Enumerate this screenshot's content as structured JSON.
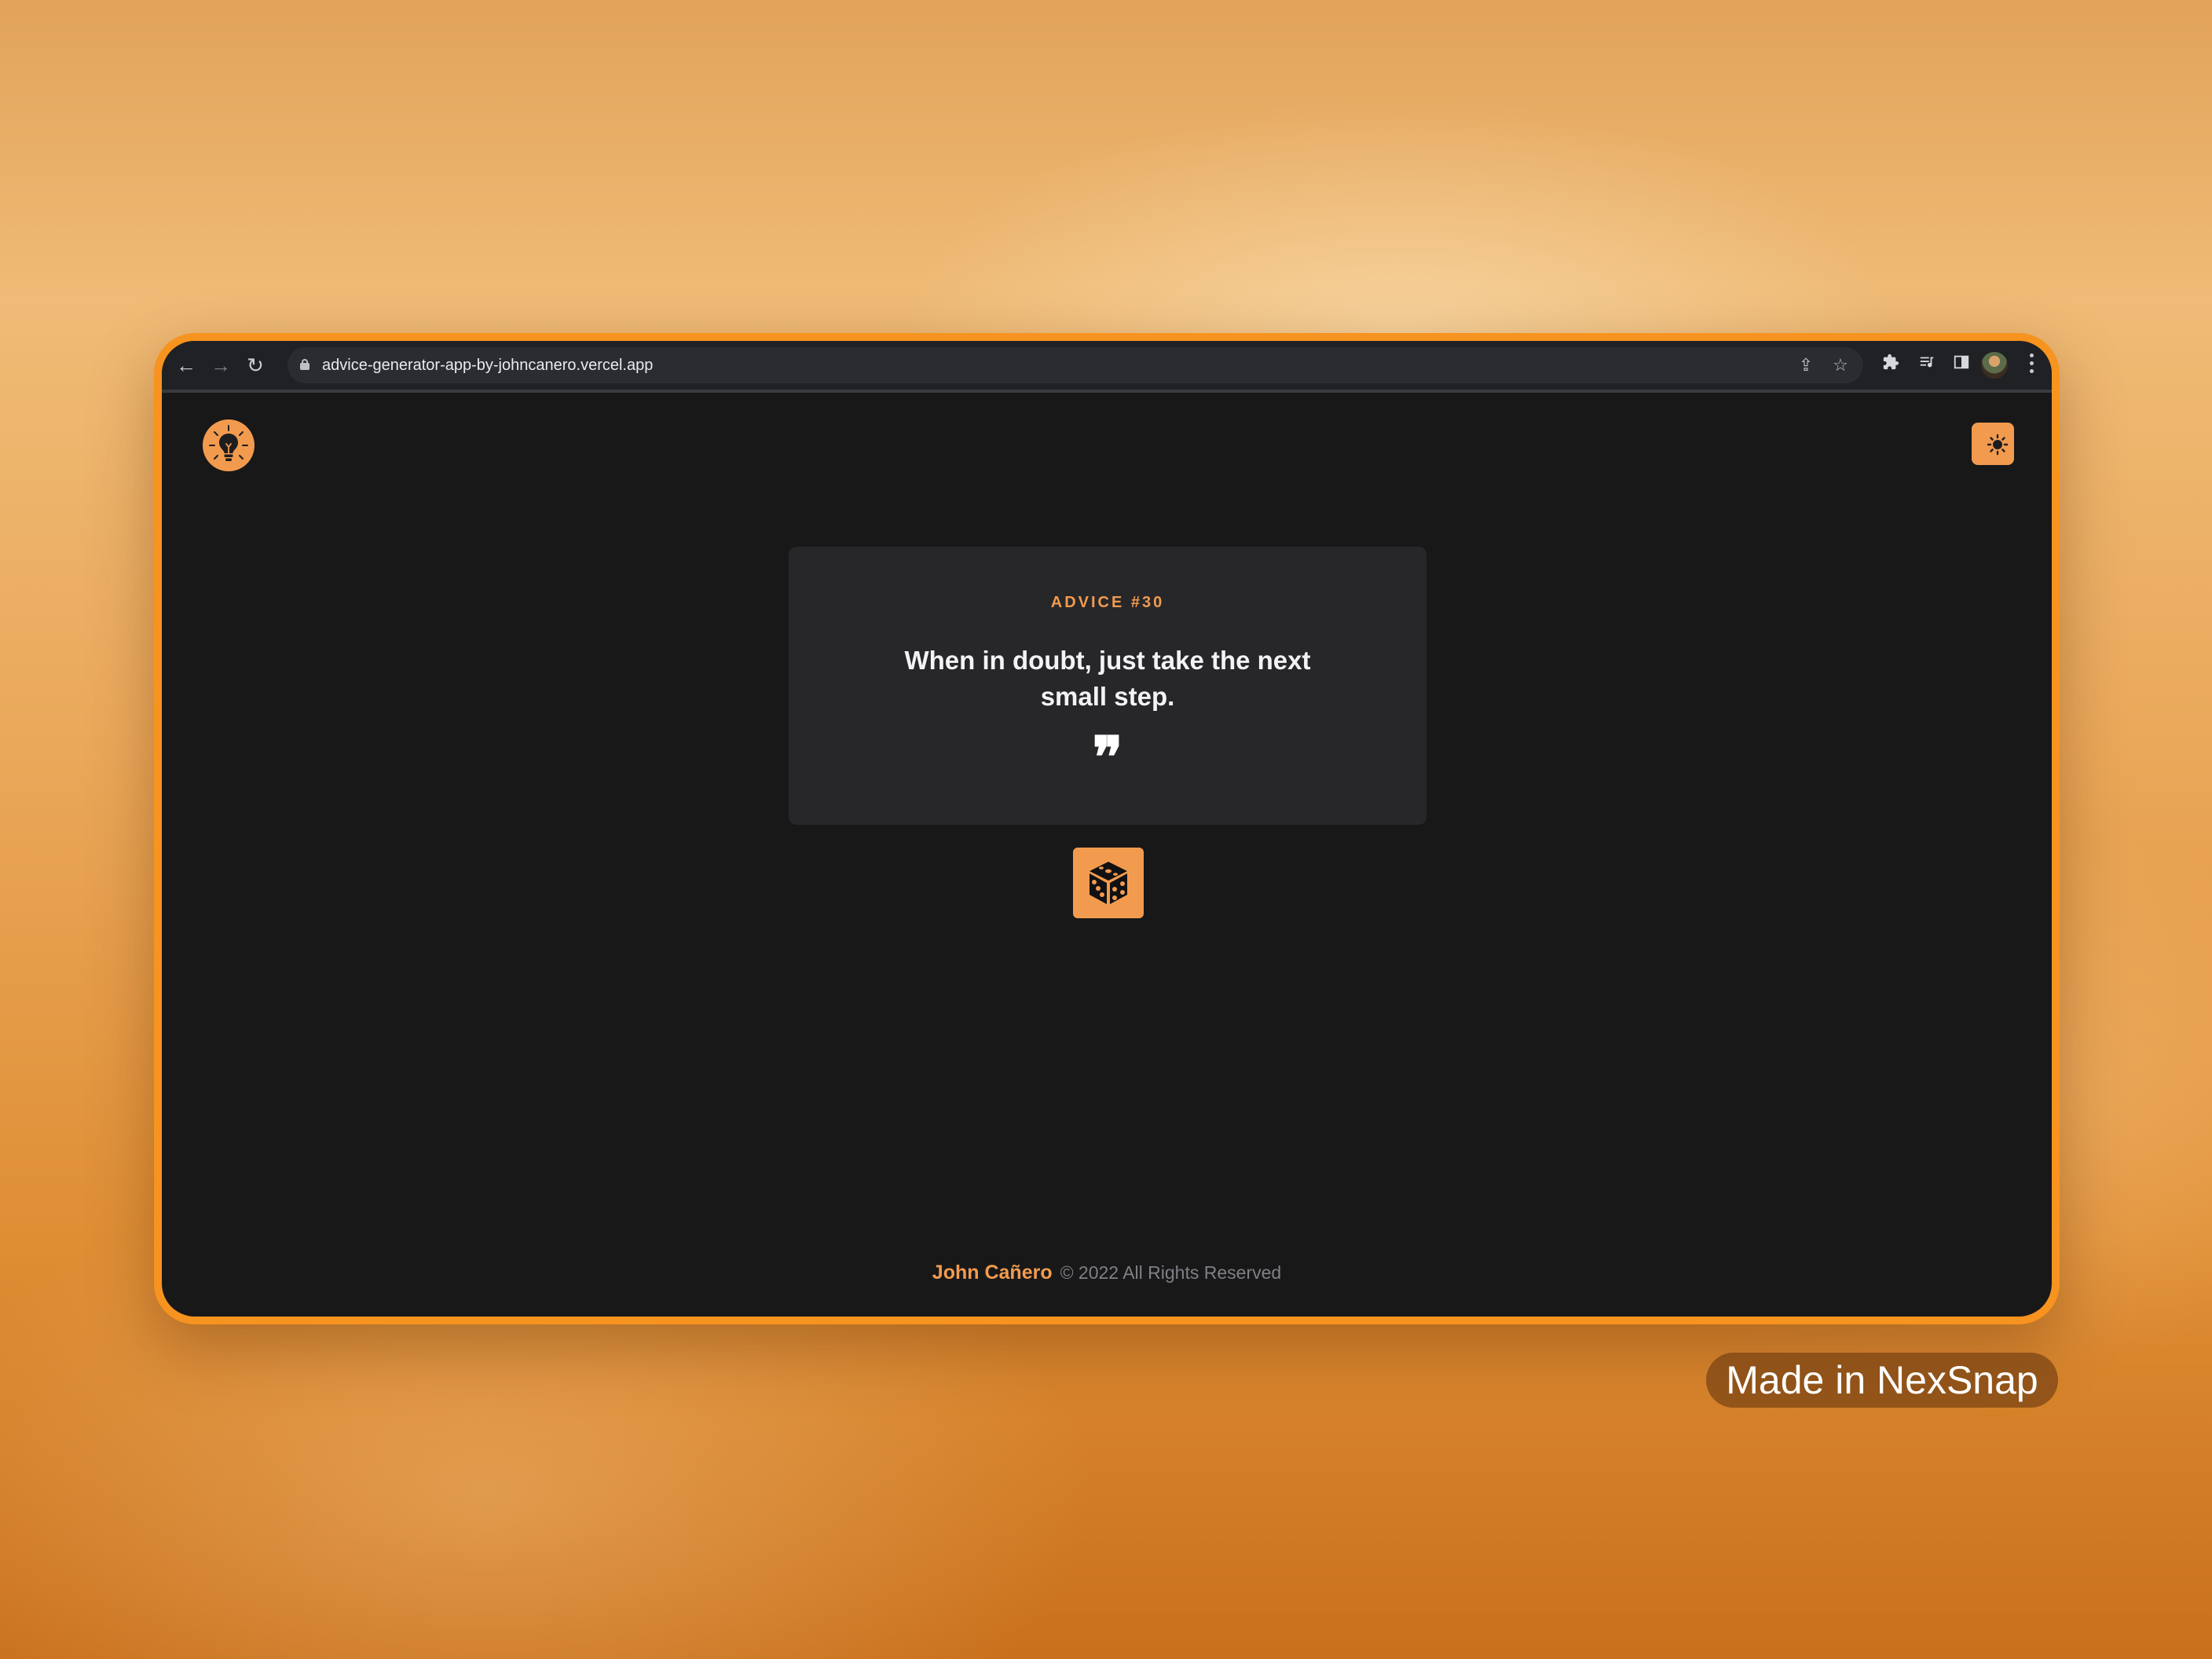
{
  "browser": {
    "url": "advice-generator-app-by-johncanero.vercel.app",
    "back_icon": "←",
    "forward_icon": "→",
    "reload_icon": "↻",
    "share_icon": "⇪",
    "star_icon": "☆"
  },
  "app": {
    "logo_icon": "lightbulb-icon",
    "theme_toggle_icon": "sun-icon",
    "advice_label": "ADVICE #30",
    "advice_text": "When in doubt, just take the next small step.",
    "quote_glyph": "❞",
    "dice_icon": "dice-icon",
    "footer_name": "John Cañero",
    "footer_rights": "© 2022 All Rights Reserved",
    "accent_color": "#f29b4e"
  },
  "watermark": {
    "label": "Made in NexSnap"
  }
}
